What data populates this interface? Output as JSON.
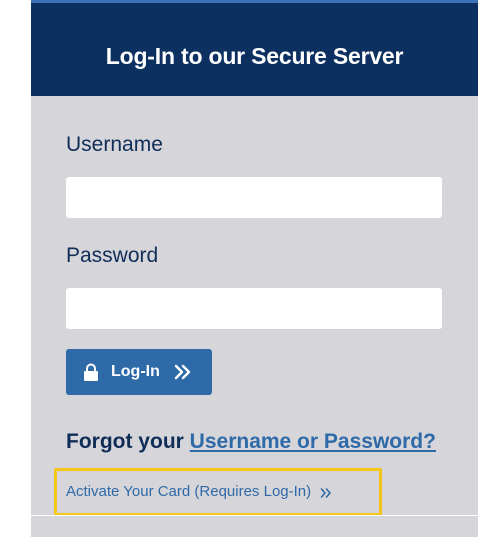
{
  "header": {
    "title": "Log-In to our Secure Server"
  },
  "form": {
    "username_label": "Username",
    "username_value": "",
    "password_label": "Password",
    "password_value": "",
    "login_label": "Log-In"
  },
  "forgot": {
    "prefix": "Forgot your",
    "link": "Username or Password?"
  },
  "activate": {
    "label": "Activate Your Card (Requires Log-In)"
  },
  "icons": {
    "lock": "lock-icon",
    "login_chevron": "double-chevron-right-icon",
    "activate_chevron": "double-chevron-right-icon"
  },
  "colors": {
    "header_bg": "#0c3060",
    "panel_bg": "#d6d5da",
    "button_bg": "#2f6aa8",
    "link": "#2f6aa8",
    "highlight": "#f5c518",
    "label_text": "#0f2d57"
  }
}
